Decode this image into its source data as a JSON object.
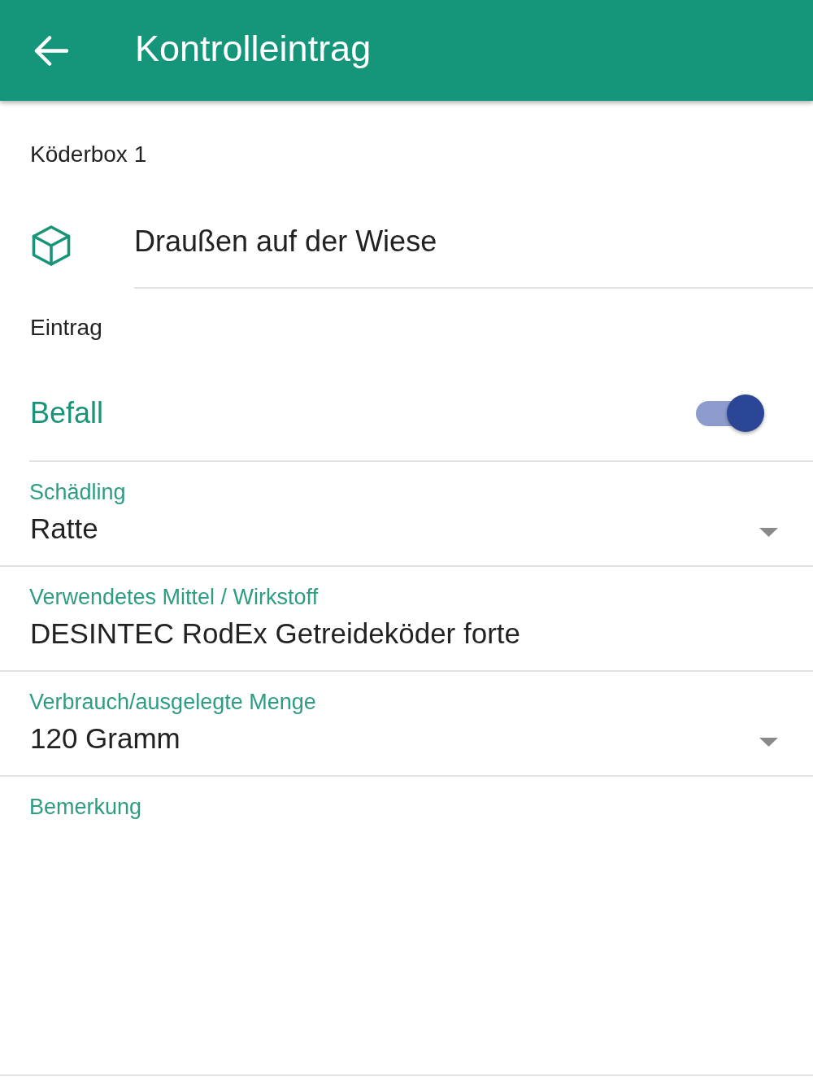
{
  "app_bar": {
    "title": "Kontrolleintrag"
  },
  "bait_box": {
    "label": "Köderbox 1",
    "location": "Draußen auf der Wiese"
  },
  "entry": {
    "heading": "Eintrag",
    "infestation": {
      "label": "Befall",
      "on": true
    }
  },
  "fields": [
    {
      "kind": "dropdown",
      "label": "Schädling",
      "value": "Ratte"
    },
    {
      "kind": "text",
      "label": "Verwendetes Mittel / Wirkstoff",
      "value": "DESINTEC RodEx Getreideköder forte"
    },
    {
      "kind": "dropdown",
      "label": "Verbrauch/ausgelegte Menge",
      "value": "120 Gramm"
    },
    {
      "kind": "textarea",
      "label": "Bemerkung"
    }
  ]
}
